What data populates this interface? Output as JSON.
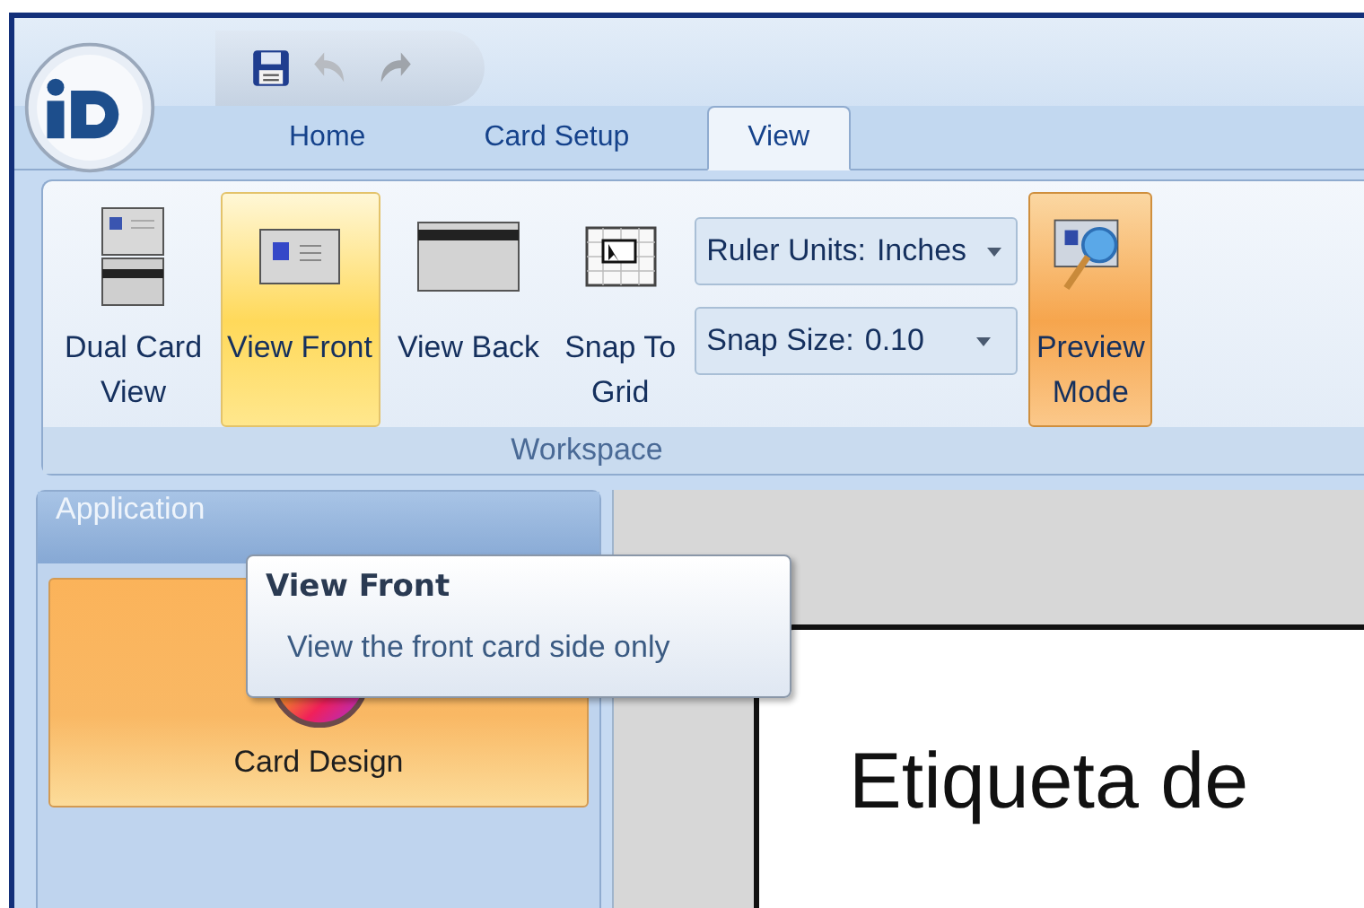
{
  "quick_access": [
    {
      "kind": "save",
      "disabled": false
    },
    {
      "kind": "undo",
      "disabled": true
    },
    {
      "kind": "redo",
      "disabled": true
    }
  ],
  "tabs": [
    {
      "label": "Home",
      "selected": false
    },
    {
      "label": "Card Setup",
      "selected": false
    },
    {
      "label": "View",
      "selected": true
    }
  ],
  "ribbon": {
    "buttons": [
      {
        "kind": "dual",
        "lines": [
          "Dual Card",
          "View"
        ],
        "hover": false,
        "pressed": false
      },
      {
        "kind": "front",
        "lines": [
          "View Front"
        ],
        "hover": true,
        "pressed": false
      },
      {
        "kind": "back",
        "lines": [
          "View Back"
        ],
        "hover": false,
        "pressed": false
      },
      {
        "kind": "grid",
        "lines": [
          "Snap To",
          "Grid"
        ],
        "hover": false,
        "pressed": false
      },
      {
        "kind": "combos"
      },
      {
        "kind": "preview",
        "lines": [
          "Preview",
          "Mode"
        ],
        "hover": false,
        "pressed": true
      }
    ],
    "combos": [
      {
        "label": "Ruler Units:",
        "value": "Inches"
      },
      {
        "label": "Snap Size:",
        "value": "0.10"
      }
    ],
    "group_label": "Workspace"
  },
  "tooltip": {
    "title": "View Front",
    "text": "View the front card side only"
  },
  "left_panel": {
    "header": "Application",
    "items": [
      {
        "label": "Card Design",
        "selected": true
      }
    ]
  },
  "canvas": {
    "card_text": "Etiqueta de"
  }
}
